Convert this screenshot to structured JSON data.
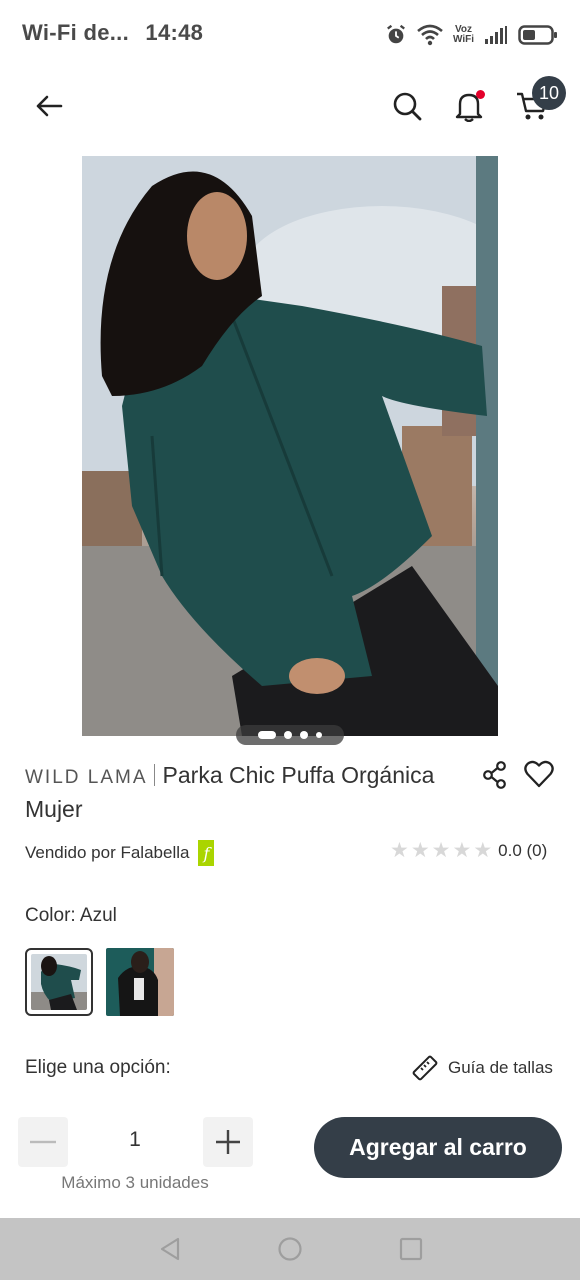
{
  "status_bar": {
    "carrier": "Wi-Fi de...",
    "time": "14:48",
    "voz_label_top": "Voz",
    "voz_label_bottom": "WiFi",
    "icons": [
      "alarm-icon",
      "wifi-icon",
      "voz-wifi-icon",
      "signal-icon",
      "battery-icon"
    ]
  },
  "header": {
    "back_icon": "arrow-left-icon",
    "search_icon": "search-icon",
    "notifications_icon": "bell-icon",
    "cart_icon": "cart-icon",
    "cart_count": "10"
  },
  "gallery": {
    "image_description_icon": "product-photo",
    "page_count": 4,
    "active_page": 1
  },
  "product": {
    "brand": "WILD LAMA",
    "name": "Parka Chic Puffa Orgánica Mujer",
    "seller_text": "Vendido por Falabella",
    "seller_logo_letter": "f",
    "rating_value": "0.0",
    "rating_count": "(0)",
    "stars_filled": 0
  },
  "color": {
    "label": "Color: Azul",
    "swatches": [
      {
        "name": "green-jacket",
        "selected": true
      },
      {
        "name": "black-jacket",
        "selected": false
      }
    ]
  },
  "options": {
    "label": "Elige una opción:",
    "size_guide": "Guía de tallas"
  },
  "purchase": {
    "quantity": "1",
    "max_units": "Máximo 3 unidades",
    "add_to_cart": "Agregar al carro"
  },
  "colors": {
    "primary_dark": "#343e48",
    "falabella_green": "#aad500",
    "notification_red": "#e4002b"
  }
}
